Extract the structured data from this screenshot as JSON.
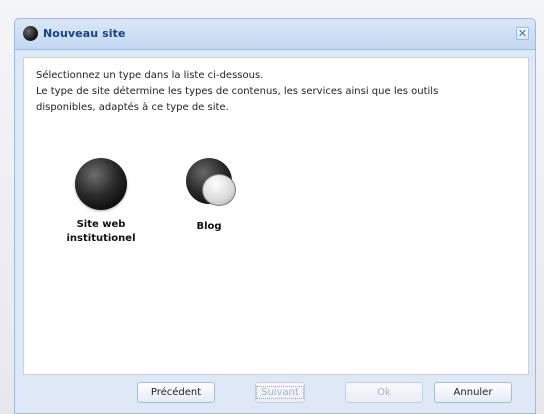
{
  "dialog": {
    "title": "Nouveau site",
    "close_symbol": "✕",
    "description_lines": [
      "Sélectionnez un type dans la liste ci-dessous.",
      "Le type de site détermine les types de contenus, les services ainsi que les outils",
      "disponibles, adaptés à ce type de site."
    ],
    "site_types": [
      {
        "label_line1": "Site web",
        "label_line2": "institutionel",
        "icon": "globe-icon"
      },
      {
        "label_line1": "Blog",
        "icon": "blog-icon"
      }
    ],
    "buttons": {
      "previous": "Précédent",
      "next": "Suivant",
      "ok": "Ok",
      "cancel": "Annuler"
    }
  },
  "colors": {
    "title_text": "#15428b",
    "frame": "#dfe8f6",
    "border": "#99bbe8"
  }
}
